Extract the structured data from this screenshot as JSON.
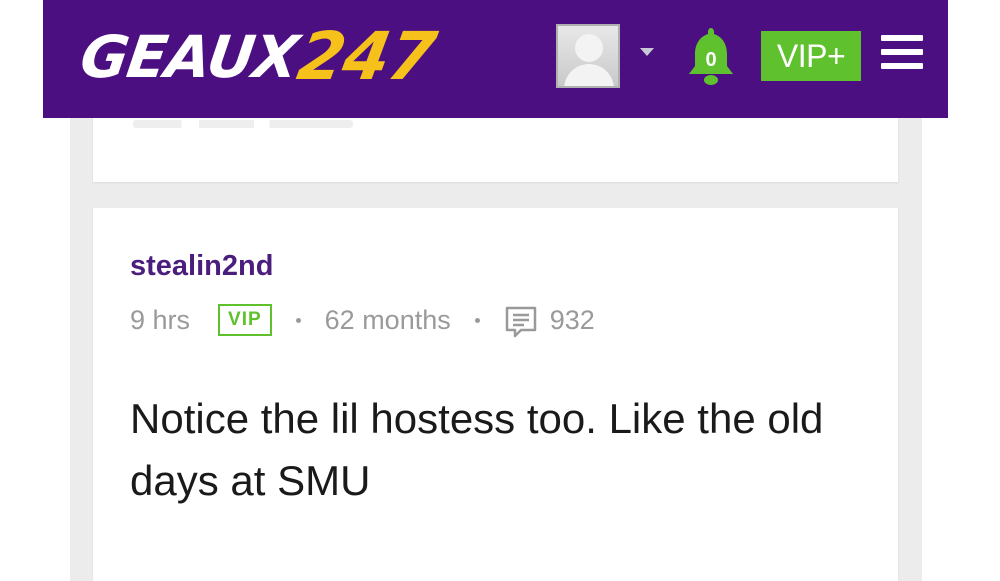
{
  "header": {
    "logo_word": "GEAUX",
    "logo_number": "247",
    "notification_count": "0",
    "vip_button_label": "VIP+"
  },
  "post": {
    "author": "stealin2nd",
    "time_ago": "9 hrs",
    "vip_badge": "VIP",
    "membership_age": "62 months",
    "message_count": "932",
    "body": "Notice the lil hostess too. Like the old days at SMU"
  },
  "colors": {
    "header_bg": "#4b0f82",
    "logo_accent": "#f5c11a",
    "vip_green": "#5fc12d",
    "author_purple": "#4b1d7d"
  },
  "icons": {
    "avatar": "user-avatar-icon",
    "dropdown": "caret-down-icon",
    "notifications": "bell-icon",
    "menu": "hamburger-menu-icon",
    "messages": "comment-icon"
  }
}
